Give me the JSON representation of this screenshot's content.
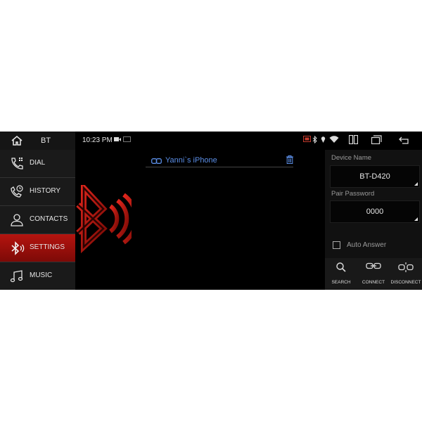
{
  "status_bar": {
    "app_title": "BT",
    "time": "10:23 PM"
  },
  "sidebar": {
    "items": [
      {
        "label": "DIAL",
        "icon": "phone-icon"
      },
      {
        "label": "HISTORY",
        "icon": "history-phone-icon"
      },
      {
        "label": "CONTACTS",
        "icon": "person-icon"
      },
      {
        "label": "SETTINGS",
        "icon": "bluetooth-icon",
        "active": true
      },
      {
        "label": "MUSIC",
        "icon": "music-note-icon"
      }
    ]
  },
  "main": {
    "paired_device": "Yanni`s iPhone"
  },
  "settings": {
    "device_name_label": "Device Name",
    "device_name_value": "BT-D420",
    "pair_password_label": "Pair Password",
    "pair_password_value": "0000",
    "auto_answer_label": "Auto Answer",
    "auto_answer_checked": false,
    "actions": [
      {
        "label": "SEARCH",
        "icon": "search-icon"
      },
      {
        "label": "CONNECT",
        "icon": "link-icon"
      },
      {
        "label": "DISCONNECT",
        "icon": "unlink-icon"
      }
    ]
  },
  "colors": {
    "accent_red": "#b5140f",
    "device_blue": "#5b8ee6"
  }
}
